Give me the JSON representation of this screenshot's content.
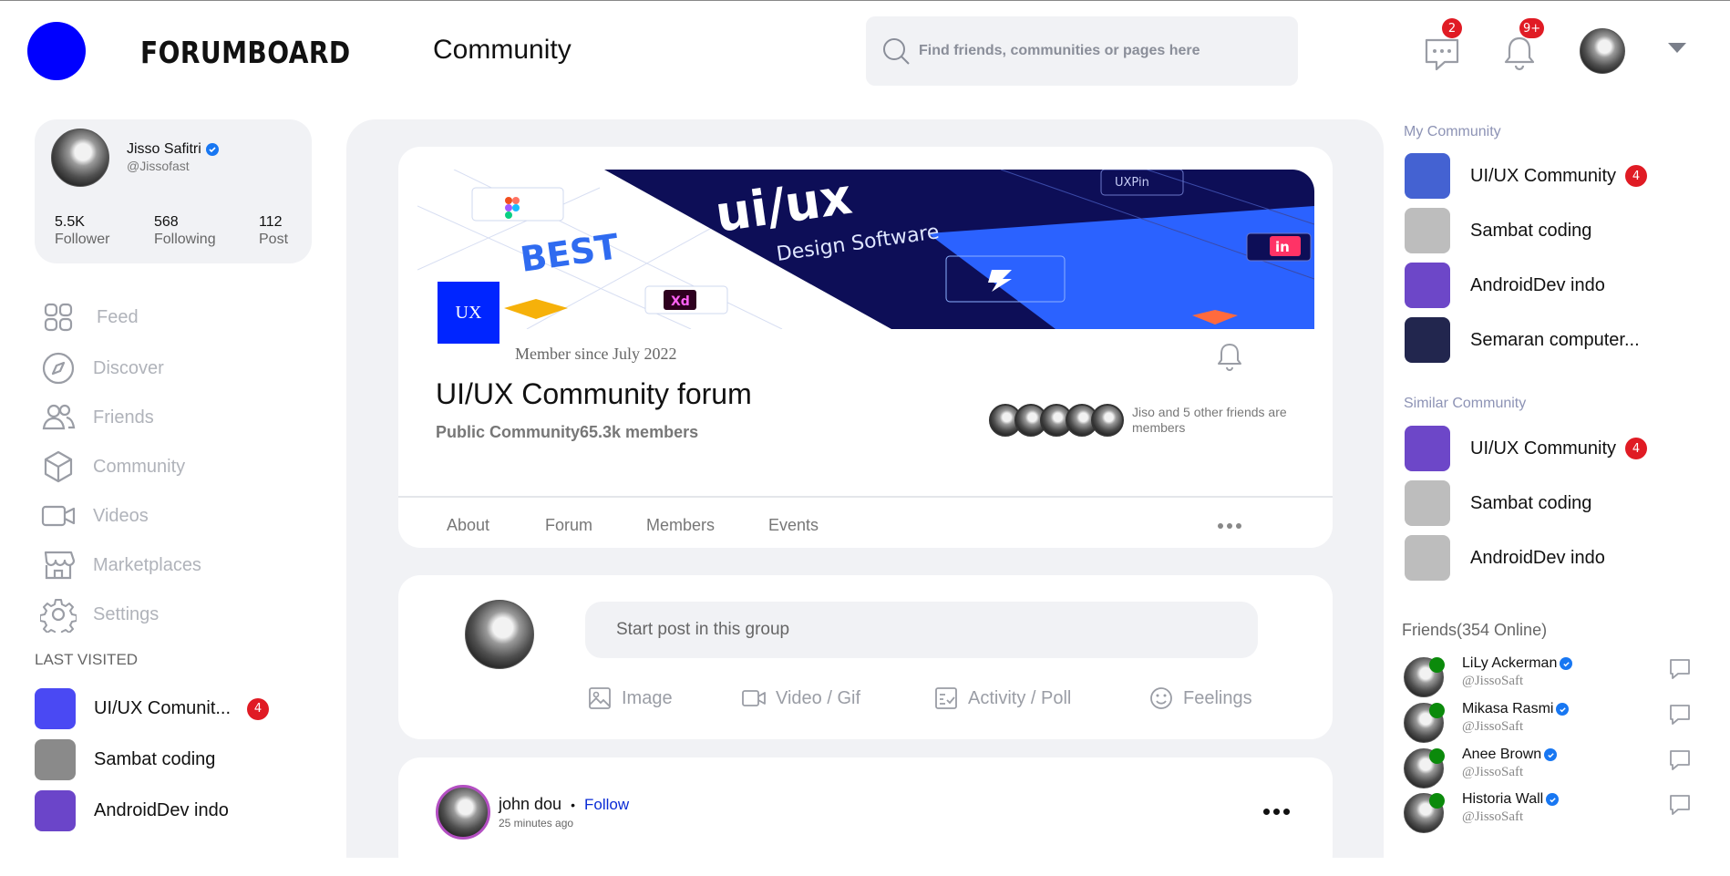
{
  "header": {
    "brand": "FORUMBOARD",
    "page_title": "Community",
    "search_placeholder": "Find friends, communities or pages here",
    "messages_badge": "2",
    "notifications_badge": "9+"
  },
  "profile": {
    "name": "Jisso Safitri",
    "handle": "@Jissofast",
    "stats": [
      {
        "num": "5.5K",
        "label": "Follower"
      },
      {
        "num": "568",
        "label": "Following"
      },
      {
        "num": "112",
        "label": "Post"
      }
    ]
  },
  "nav": {
    "items": [
      {
        "label": "Feed"
      },
      {
        "label": "Discover"
      },
      {
        "label": "Friends"
      },
      {
        "label": "Community"
      },
      {
        "label": "Videos"
      },
      {
        "label": "Marketplaces"
      },
      {
        "label": "Settings"
      }
    ]
  },
  "last_visited": {
    "label": "LAST VISITED",
    "items": [
      {
        "name": "UI/UX Comunit...",
        "badge": "4",
        "color": "#4a49f3"
      },
      {
        "name": "Sambat coding",
        "color": "#8a8a8a"
      },
      {
        "name": "AndroidDev indo",
        "color": "#6b45c9"
      }
    ]
  },
  "group": {
    "logo_text": "UX",
    "member_since": "Member since July 2022",
    "title": "UI/UX Community forum",
    "subtitle": "Public Community65.3k members",
    "friends_text": "Jiso and 5 other friends are members",
    "cover": {
      "headline": "ui/ux",
      "subheadline": "Design Software",
      "best": "BEST",
      "xd": "Xd",
      "uxpin": "UXPin",
      "in": "in"
    },
    "tabs": [
      {
        "label": "About"
      },
      {
        "label": "Forum"
      },
      {
        "label": "Members"
      },
      {
        "label": "Events"
      }
    ]
  },
  "composer": {
    "placeholder": "Start post in this group",
    "actions": [
      {
        "label": "Image"
      },
      {
        "label": "Video / Gif"
      },
      {
        "label": "Activity / Poll"
      },
      {
        "label": "Feelings"
      }
    ]
  },
  "post": {
    "author": "john dou",
    "follow": "Follow",
    "time": "25 minutes ago"
  },
  "right": {
    "my_community_label": "My Community",
    "my_community": [
      {
        "name": "UI/UX Community",
        "badge": "4",
        "color": "#4462d2"
      },
      {
        "name": "Sambat coding",
        "color": "#bdbdbd"
      },
      {
        "name": "AndroidDev indo",
        "color": "#6d47c8"
      },
      {
        "name": "Semaran computer...",
        "color": "#22264e"
      }
    ],
    "similar_label": "Similar Community",
    "similar": [
      {
        "name": "UI/UX Community",
        "badge": "4",
        "color": "#6d47c8"
      },
      {
        "name": "Sambat coding",
        "color": "#bdbdbd"
      },
      {
        "name": "AndroidDev indo",
        "color": "#bdbdbd"
      }
    ],
    "friends_label": "Friends(354 Online)",
    "friends": [
      {
        "name": "LiLy Ackerman",
        "handle": "@JissoSaft"
      },
      {
        "name": "Mikasa Rasmi",
        "handle": "@JissoSaft"
      },
      {
        "name": "Anee Brown",
        "handle": "@JissoSaft"
      },
      {
        "name": "Historia Wall",
        "handle": "@JissoSaft"
      }
    ]
  }
}
